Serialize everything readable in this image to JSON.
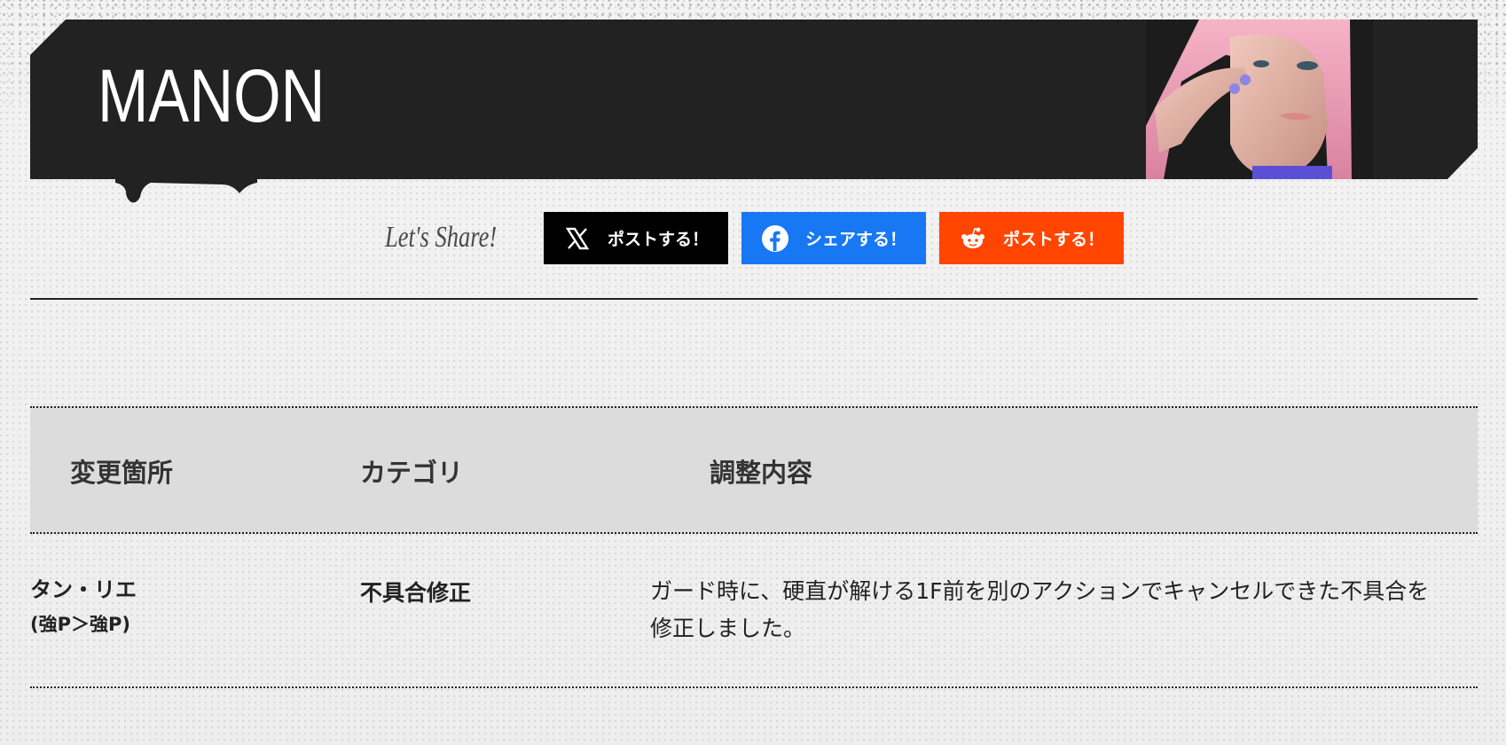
{
  "banner": {
    "title": "MANON",
    "portrait": "character-portrait"
  },
  "share": {
    "label": "Let's Share!",
    "buttons": [
      {
        "label": "ポストする！",
        "icon": "x-logo-icon",
        "color": "#000000"
      },
      {
        "label": "シェアする！",
        "icon": "facebook-logo-icon",
        "color": "#1877f2"
      },
      {
        "label": "ポストする！",
        "icon": "reddit-logo-icon",
        "color": "#ff4500"
      }
    ]
  },
  "table": {
    "headers": [
      "変更箇所",
      "カテゴリ",
      "調整内容"
    ],
    "rows": [
      {
        "part_name": "タン・リエ",
        "part_command": "(強P＞強P)",
        "category": "不具合修正",
        "description": "ガード時に、硬直が解ける1F前を別のアクションでキャンセルできた不具合を修正しました。"
      }
    ]
  }
}
